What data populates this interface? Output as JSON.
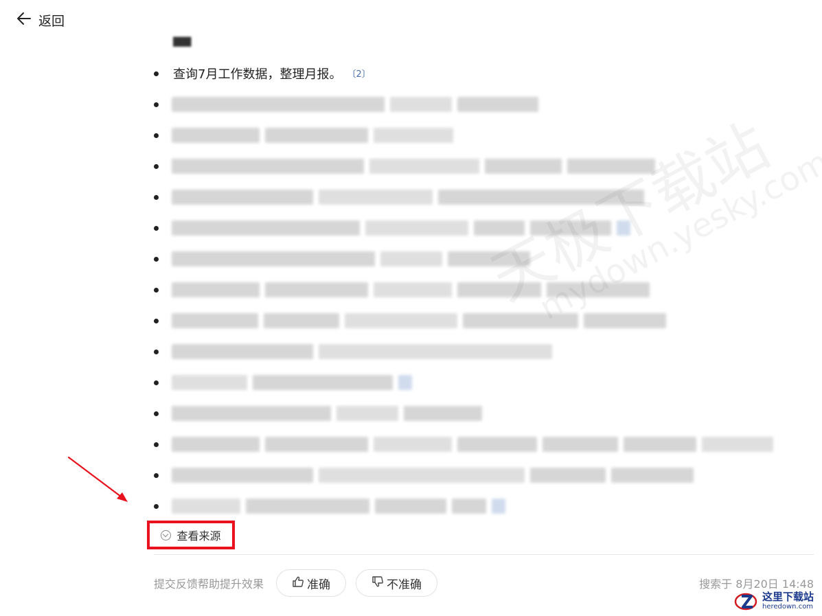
{
  "topbar": {
    "back_label": "返回"
  },
  "results": {
    "visible_item": {
      "text": "查询7月工作数据，整理月报。",
      "citation": "〔2〕"
    },
    "obscured_row_count_note": ""
  },
  "view_sources": {
    "label": "查看来源"
  },
  "feedback": {
    "hint": "提交反馈帮助提升效果",
    "accurate_label": "准确",
    "inaccurate_label": "不准确",
    "search_time": "搜索于 8月20日 14:48"
  },
  "watermark": {
    "cn": "天极下载站",
    "url": "mydown.yesky.com"
  },
  "corner_logo": {
    "cn": "这里下载站",
    "en": "heredown.com"
  },
  "colors": {
    "highlight": "#e8111d",
    "citation": "#4a6ea8",
    "muted": "#999999"
  }
}
